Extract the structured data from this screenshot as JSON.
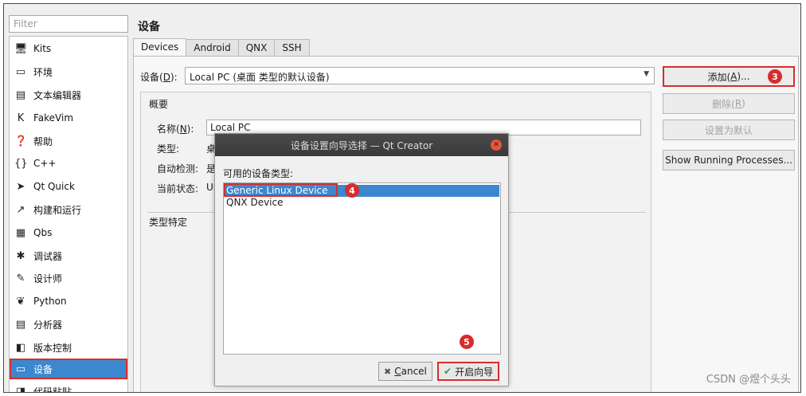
{
  "sidebar": {
    "filter_placeholder": "Filter",
    "items": [
      {
        "label": "Kits",
        "icon": "kits-icon",
        "glyph": "🖥"
      },
      {
        "label": "环境",
        "icon": "environment-icon",
        "glyph": "▭"
      },
      {
        "label": "文本编辑器",
        "icon": "text-editor-icon",
        "glyph": "▤"
      },
      {
        "label": "FakeVim",
        "icon": "fakevim-icon",
        "glyph": "K"
      },
      {
        "label": "帮助",
        "icon": "help-icon",
        "glyph": "❓"
      },
      {
        "label": "C++",
        "icon": "cpp-icon",
        "glyph": "{}"
      },
      {
        "label": "Qt Quick",
        "icon": "qt-quick-icon",
        "glyph": "➤"
      },
      {
        "label": "构建和运行",
        "icon": "build-run-icon",
        "glyph": "↗"
      },
      {
        "label": "Qbs",
        "icon": "qbs-icon",
        "glyph": "▦"
      },
      {
        "label": "调试器",
        "icon": "debugger-icon",
        "glyph": "✱"
      },
      {
        "label": "设计师",
        "icon": "designer-icon",
        "glyph": "✎"
      },
      {
        "label": "Python",
        "icon": "python-icon",
        "glyph": "❦"
      },
      {
        "label": "分析器",
        "icon": "analyzer-icon",
        "glyph": "▤"
      },
      {
        "label": "版本控制",
        "icon": "version-control-icon",
        "glyph": "◧"
      },
      {
        "label": "设备",
        "icon": "devices-icon",
        "glyph": "▭"
      },
      {
        "label": "代码粘贴",
        "icon": "code-paste-icon",
        "glyph": "◨"
      }
    ],
    "selected": "设备"
  },
  "main": {
    "title": "设备",
    "tabs": [
      "Devices",
      "Android",
      "QNX",
      "SSH"
    ],
    "active_tab": "Devices",
    "device_label": "设备(",
    "device_label_key": "D",
    "device_label_end": "):",
    "device_value": "Local PC (桌面 类型的默认设备)",
    "overview_title": "概要",
    "name_label": "名称(",
    "name_label_key": "N",
    "name_label_end": "):",
    "name_value": "Local PC",
    "type_label": "类型:",
    "type_value": "桌",
    "autodetect_label": "自动检测:",
    "autodetect_value": "是",
    "state_label": "当前状态:",
    "state_value": "Un",
    "type_specific_title": "类型特定"
  },
  "buttons": {
    "add": "添加(",
    "add_key": "A",
    "add_end": ")...",
    "remove": "删除(",
    "remove_key": "R",
    "remove_end": ")",
    "set_default": "设置为默认",
    "show_processes": "Show Running Processes..."
  },
  "dialog": {
    "title": "设备设置向导选择 — Qt Creator",
    "label": "可用的设备类型:",
    "items": [
      "Generic Linux Device",
      "QNX Device"
    ],
    "selected_item": "Generic Linux Device",
    "cancel_label_key": "C",
    "cancel_label_rest": "ancel",
    "start_label": "开启向导"
  },
  "badges": {
    "add": "3",
    "generic_linux": "4",
    "start": "5"
  },
  "watermark": "CSDN @煜个头头",
  "colors": {
    "selection": "#3d87cf",
    "highlight": "#d62d2d"
  }
}
